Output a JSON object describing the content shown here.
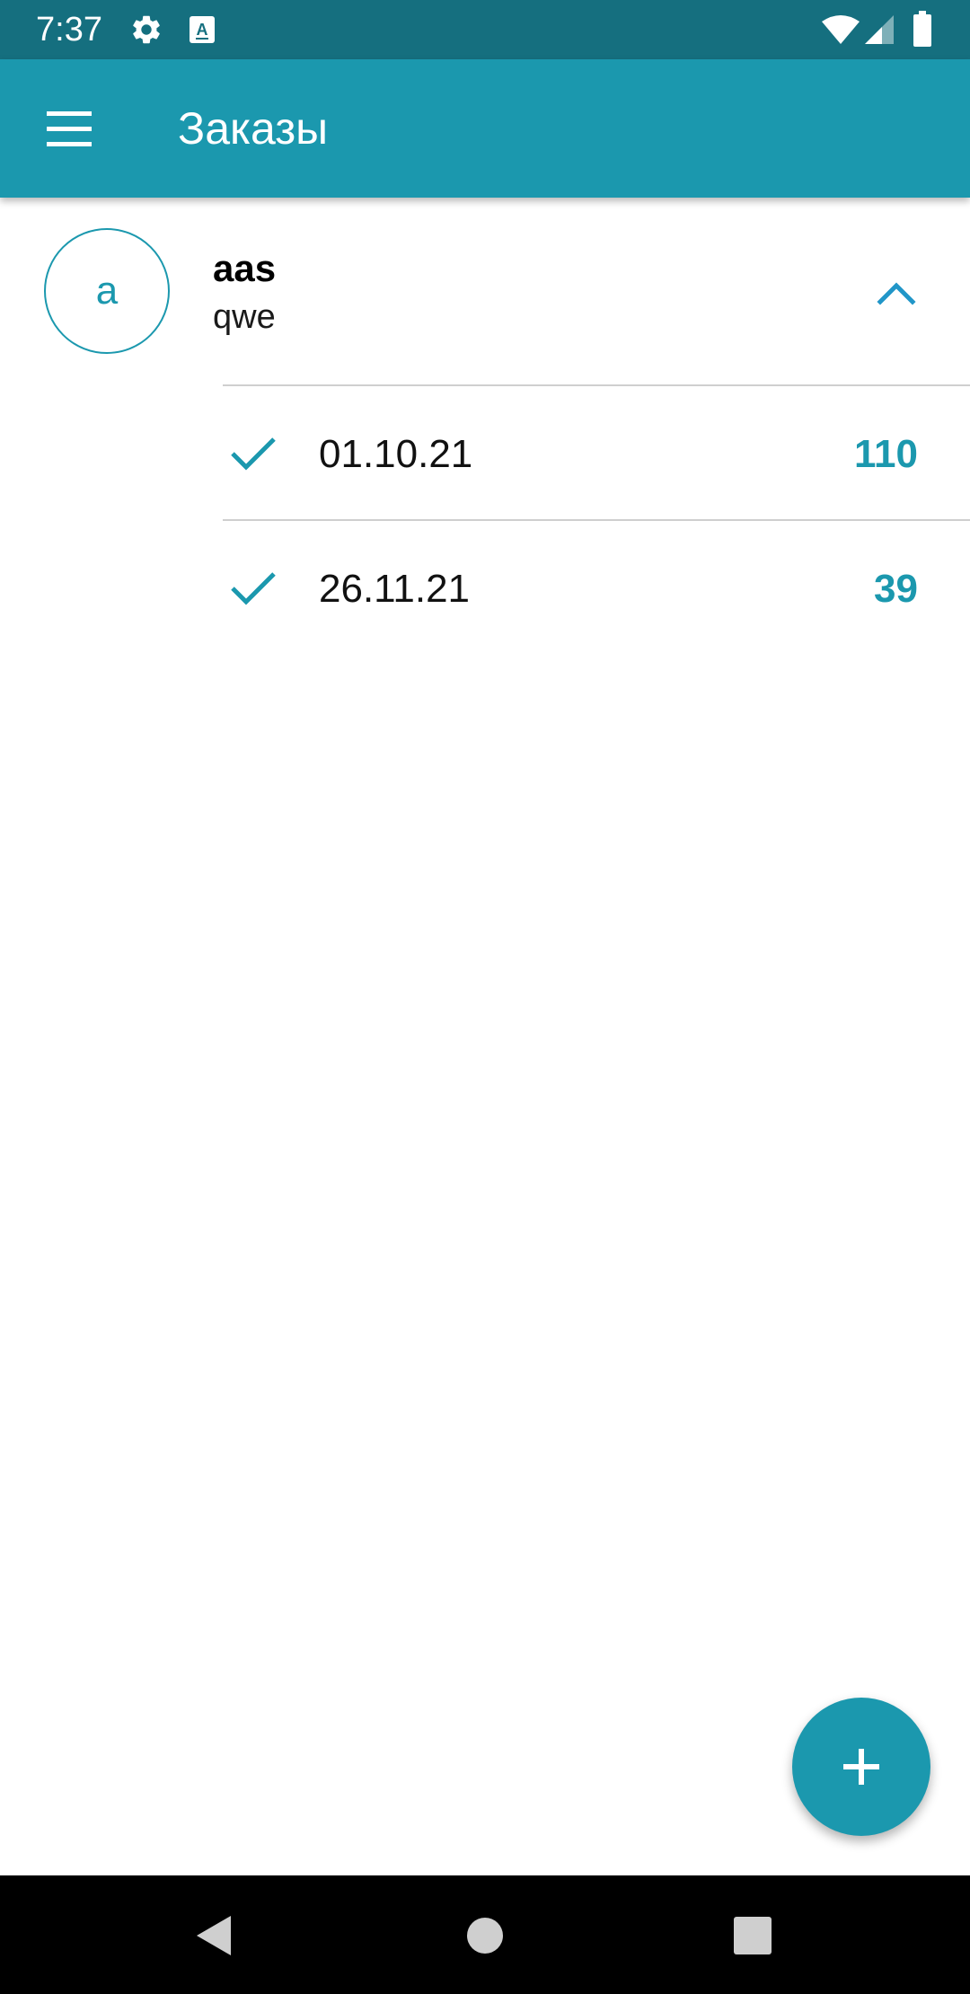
{
  "status_bar": {
    "time": "7:37",
    "icons": [
      "settings-icon",
      "text-a-icon",
      "wifi-icon",
      "cell-signal-icon",
      "battery-icon"
    ]
  },
  "app_bar": {
    "title": "Заказы",
    "menu_icon": "hamburger-menu-icon"
  },
  "group": {
    "avatar_letter": "a",
    "name": "aas",
    "subtitle": "qwe",
    "expanded": true,
    "toggle_icon": "chevron-up-icon"
  },
  "orders": [
    {
      "date": "01.10.21",
      "amount": "110",
      "status_icon": "check-icon"
    },
    {
      "date": "26.11.21",
      "amount": "39",
      "status_icon": "check-icon"
    }
  ],
  "fab": {
    "icon": "plus-icon"
  },
  "nav_bar": {
    "buttons": [
      "back-icon",
      "home-icon",
      "recents-icon"
    ]
  },
  "colors": {
    "status_bar": "#156f7f",
    "app_bar": "#1b98ae",
    "accent": "#1b98ae",
    "chevron": "#2196c8"
  }
}
